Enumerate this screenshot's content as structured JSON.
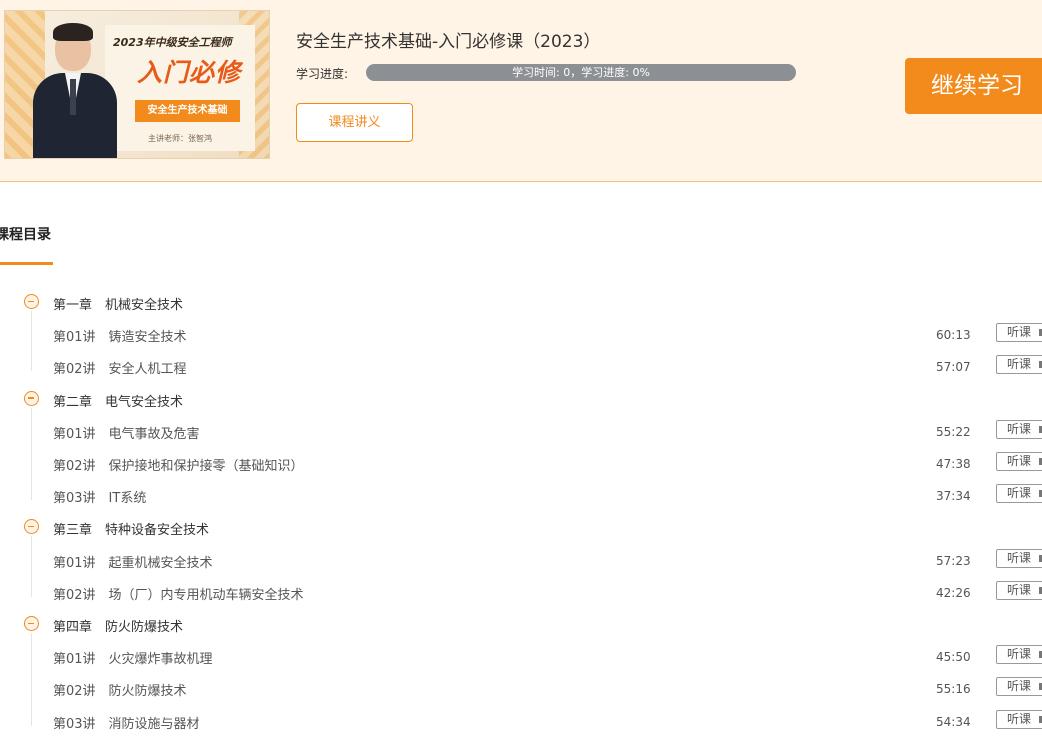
{
  "thumbnail": {
    "year_title": "2023年中级安全工程师",
    "main_title": "入门必修",
    "badge": "安全生产技术基础",
    "teacher": "主讲老师：张智鸿"
  },
  "course": {
    "title": "安全生产技术基础-入门必修课（2023）",
    "progress_label": "学习进度:",
    "progress_text": "学习时间: 0，学习进度: 0%",
    "progress_value": 0,
    "notes_button": "课程讲义",
    "continue_button": "继续学习"
  },
  "catalog": {
    "title": "课程目录",
    "listen_label": "听课",
    "chapters": [
      {
        "label": "第一章　机械安全技术",
        "lectures": [
          {
            "label": "第01讲　铸造安全技术",
            "duration": "60:13"
          },
          {
            "label": "第02讲　安全人机工程",
            "duration": "57:07"
          }
        ]
      },
      {
        "label": "第二章　电气安全技术",
        "lectures": [
          {
            "label": "第01讲　电气事故及危害",
            "duration": "55:22"
          },
          {
            "label": "第02讲　保护接地和保护接零（基础知识）",
            "duration": "47:38"
          },
          {
            "label": "第03讲　IT系统",
            "duration": "37:34"
          }
        ]
      },
      {
        "label": "第三章　特种设备安全技术",
        "lectures": [
          {
            "label": "第01讲　起重机械安全技术",
            "duration": "57:23"
          },
          {
            "label": "第02讲　场（厂）内专用机动车辆安全技术",
            "duration": "42:26"
          }
        ]
      },
      {
        "label": "第四章　防火防爆技术",
        "lectures": [
          {
            "label": "第01讲　火灾爆炸事故机理",
            "duration": "45:50"
          },
          {
            "label": "第02讲　防火防爆技术",
            "duration": "55:16"
          },
          {
            "label": "第03讲　消防设施与器材",
            "duration": "54:34"
          }
        ]
      }
    ]
  },
  "colors": {
    "accent": "#f28a1c",
    "header_bg": "#fff4e5",
    "progress_track": "#8c8f94"
  }
}
